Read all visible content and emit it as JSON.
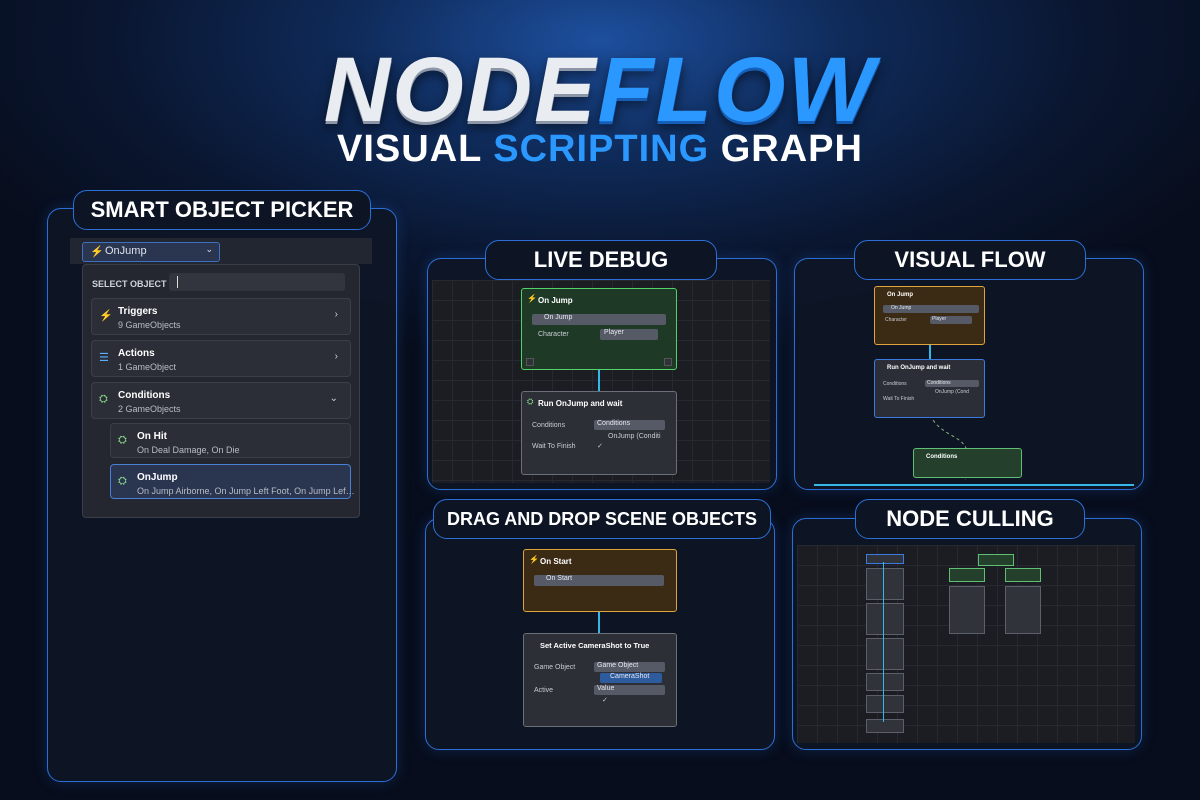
{
  "header": {
    "logo_part1": "NODE",
    "logo_part2": "FLOW",
    "subtitle_part1": "VISUAL",
    "subtitle_part2": "SCRIPTING",
    "subtitle_part3": "GRAPH"
  },
  "picker": {
    "title": "SMART OBJECT PICKER",
    "dropdown_value": "OnJump",
    "select_label": "SELECT OBJECT",
    "items": [
      {
        "title": "Triggers",
        "subtitle": "9 GameObjects",
        "icon": "lightning-icon"
      },
      {
        "title": "Actions",
        "subtitle": "1 GameObject",
        "icon": "list-icon"
      },
      {
        "title": "Conditions",
        "subtitle": "2 GameObjects",
        "icon": "toggle-icon"
      },
      {
        "title": "On Hit",
        "subtitle": "On Deal Damage, On Die",
        "icon": "toggle-icon"
      },
      {
        "title": "OnJump",
        "subtitle": "On Jump Airborne, On Jump Left Foot, On Jump Lef…",
        "icon": "toggle-icon"
      }
    ]
  },
  "live_debug": {
    "title": "LIVE DEBUG",
    "node1": {
      "title": "On Jump",
      "dropdown": "On Jump",
      "field_label": "Character",
      "field_value": "Player"
    },
    "node2": {
      "title": "Run OnJump and wait",
      "conditions_label": "Conditions",
      "conditions_value": "Conditions",
      "ref_value": "OnJump (Conditi",
      "wait_label": "Wait To Finish"
    }
  },
  "visual_flow": {
    "title": "VISUAL FLOW",
    "node1": {
      "title": "On Jump",
      "dropdown": "On Jump",
      "field_label": "Character",
      "field_value": "Player"
    },
    "node2": {
      "title": "Run OnJump and wait",
      "conditions_label": "Conditions",
      "conditions_value": "Conditions",
      "ref_value": "OnJump (Cond",
      "wait_label": "Wait To Finish"
    },
    "node3": {
      "title": "Conditions"
    }
  },
  "drag_drop": {
    "title": "DRAG AND DROP SCENE OBJECTS",
    "node1": {
      "title": "On Start",
      "dropdown": "On Start"
    },
    "node2": {
      "title": "Set Active CameraShot to True",
      "go_label": "Game Object",
      "go_value": "Game Object",
      "ref_value": "CameraShot",
      "active_label": "Active",
      "active_value": "Value"
    }
  },
  "node_culling": {
    "title": "NODE CULLING"
  },
  "colors": {
    "accent_blue": "#2b98ff",
    "panel_border": "#2b6fd6",
    "node_orange": "#e0a43a",
    "node_green": "#52d36a"
  }
}
